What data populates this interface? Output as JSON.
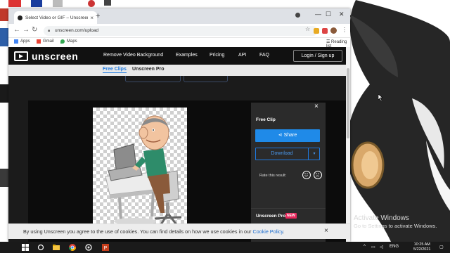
{
  "browser": {
    "tab_title": "Select Video or GIF – Unscreen",
    "tab_close": "×",
    "new_tab": "+",
    "window_controls": [
      "—",
      "☐",
      "✕"
    ],
    "url": "unscreen.com/upload",
    "bookmarks": [
      {
        "label": "Apps",
        "icon": "apps-grid-icon",
        "color": "#4285f4"
      },
      {
        "label": "Gmail",
        "icon": "gmail-icon",
        "color": "#ea4335"
      },
      {
        "label": "Maps",
        "icon": "maps-icon",
        "color": "#34a853"
      }
    ],
    "reading_list": "Reading list"
  },
  "site": {
    "logo_text": "unscreen",
    "nav": [
      "Remove Video Background",
      "Examples",
      "Pricing",
      "API",
      "FAQ"
    ],
    "login": "Login / Sign up",
    "subtabs": {
      "active": "Free Clips",
      "inactive": "Unscreen Pro"
    }
  },
  "panel": {
    "close": "×",
    "title": "Free Clip",
    "share": "Share",
    "download": "Download",
    "download_caret": "▾",
    "rate_prompt": "Rate this result:",
    "pro_label": "Unscreen Pro",
    "new_badge": "NEW"
  },
  "cookie": {
    "text": "By using Unscreen you agree to the use of cookies. You can find details on how we use cookies in our ",
    "link": "Cookie Policy",
    "end": ".",
    "close": "×"
  },
  "desktop": {
    "activate_title": "Activate Windows",
    "activate_sub": "Go to Settings to activate Windows."
  },
  "taskbar": {
    "tray_lang": "ENG",
    "time": "10:25 AM",
    "date": "5/22/2021"
  },
  "colors": {
    "accent": "#1f8ae8",
    "pink_badge": "#e8285c",
    "page_bg": "#1b1b1b"
  }
}
